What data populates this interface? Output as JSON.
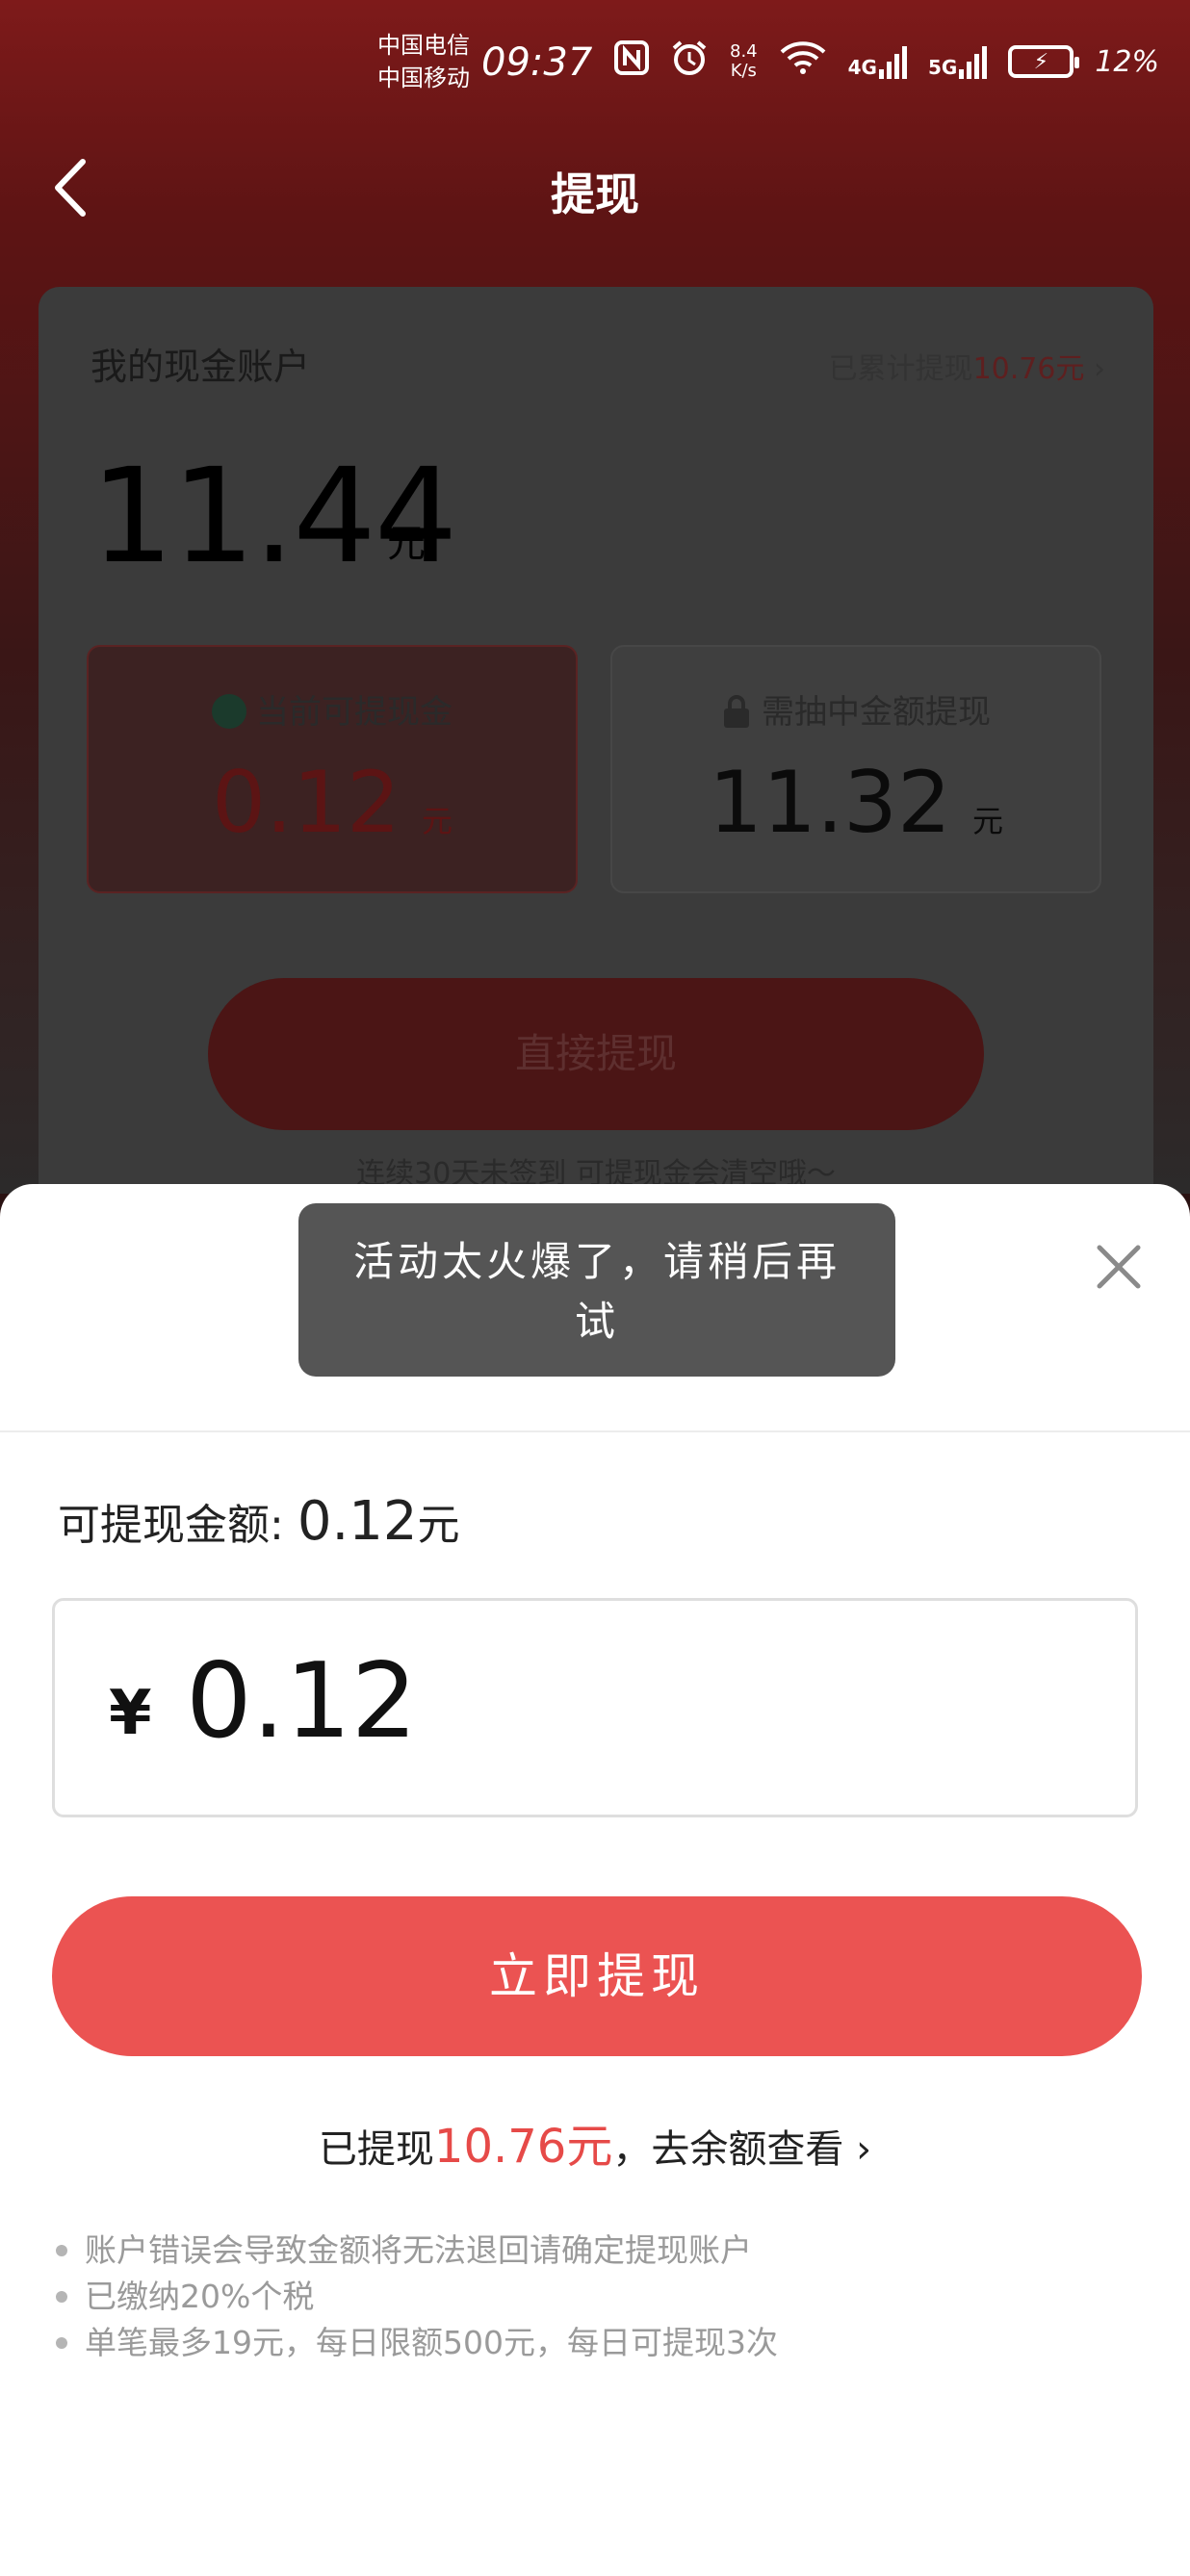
{
  "status_bar": {
    "carrier_1": "中国电信",
    "carrier_2": "中国移动",
    "time": "09:37",
    "speed_value": "8.4",
    "speed_unit": "K/s",
    "net_1": "4G",
    "net_2": "5G",
    "battery": "12%"
  },
  "header": {
    "title": "提现"
  },
  "account": {
    "title": "我的现金账户",
    "total_prefix": "已累计提现",
    "total_amount": "10.76元",
    "balance": "11.44",
    "balance_unit": "元",
    "withdrawable_label": "当前可提现金",
    "withdrawable_value": "0.12",
    "withdrawable_unit": "元",
    "locked_label": "需抽中金额提现",
    "locked_value": "11.32",
    "locked_unit": "元",
    "direct_button": "直接提现",
    "hint": "连续30天未签到 可提现金会清空哦～"
  },
  "sheet": {
    "available_label": "可提现金额:",
    "available_value": "0.12",
    "available_unit": "元",
    "currency": "¥",
    "amount_value": "0.12",
    "submit_label": "立即提现",
    "history_prefix": "已提现",
    "history_amount": "10.76元",
    "history_suffix": "，去余额查看",
    "notes": [
      "账户错误会导致金额将无法退回请确定提现账户",
      "已缴纳20%个税",
      "单笔最多19元，每日限额500元，每日可提现3次"
    ]
  },
  "toast": {
    "message": "活动太火爆了，请稍后再试"
  },
  "colors": {
    "accent": "#eb5352",
    "accent_text": "#e64a48",
    "header_bg": "#7e1a1a"
  },
  "icons": [
    "back-arrow-icon",
    "close-icon",
    "check-circle-icon",
    "lock-icon",
    "chevron-right-icon",
    "wifi-icon",
    "nfc-icon",
    "alarm-icon",
    "battery-icon"
  ]
}
